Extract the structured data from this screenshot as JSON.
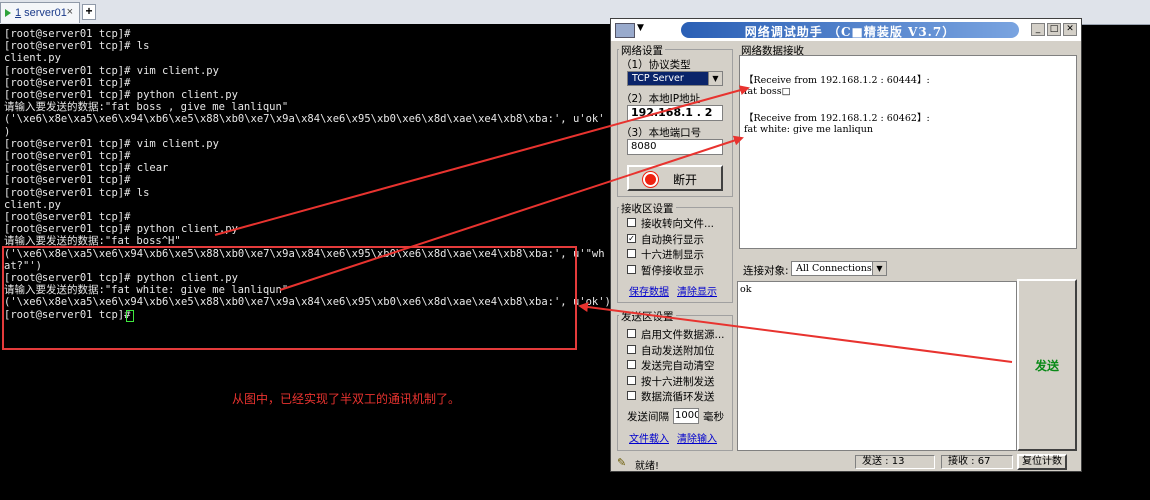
{
  "tab": {
    "number": "1",
    "name": "server01",
    "close": "×",
    "add": "+"
  },
  "terminal": {
    "lines": [
      "[root@server01 tcp]#",
      "[root@server01 tcp]# ls",
      "client.py",
      "[root@server01 tcp]# vim client.py",
      "[root@server01 tcp]#",
      "[root@server01 tcp]# python client.py",
      "请输入要发送的数据:\"fat boss , give me lanliqun\"",
      "('\\xe6\\x8e\\xa5\\xe6\\x94\\xb6\\xe5\\x88\\xb0\\xe7\\x9a\\x84\\xe6\\x95\\xb0\\xe6\\x8d\\xae\\xe4\\xb8\\xba:', u'ok'",
      ")",
      "[root@server01 tcp]# vim client.py",
      "[root@server01 tcp]#",
      "[root@server01 tcp]# clear",
      "[root@server01 tcp]#",
      "[root@server01 tcp]# ls",
      "client.py",
      "[root@server01 tcp]#",
      "[root@server01 tcp]# python client.py",
      "请输入要发送的数据:\"fat boss^H\"",
      "('\\xe6\\x8e\\xa5\\xe6\\x94\\xb6\\xe5\\x88\\xb0\\xe7\\x9a\\x84\\xe6\\x95\\xb0\\xe6\\x8d\\xae\\xe4\\xb8\\xba:', u'\"wh",
      "at?\"')",
      "[root@server01 tcp]# python client.py",
      "请输入要发送的数据:\"fat white: give me lanliqun\"",
      "('\\xe6\\x8e\\xa5\\xe6\\x94\\xb6\\xe5\\x88\\xb0\\xe7\\x9a\\x84\\xe6\\x95\\xb0\\xe6\\x8d\\xae\\xe4\\xb8\\xba:', u'ok')",
      "[root@server01 tcp]# "
    ],
    "caption": "从图中，已经实现了半双工的通讯机制了。"
  },
  "app": {
    "title": "网络调试助手 （C■精装版 V3.7）",
    "net_settings": {
      "group": "网络设置",
      "protocol_label": "（1）协议类型",
      "protocol_value": "TCP Server",
      "ip_label": "（2）本地IP地址",
      "ip_value": "192.168.1 . 2",
      "port_label": "（3）本地端口号",
      "port_value": "8080",
      "disconnect_label": "断开"
    },
    "recv_settings": {
      "group": "接收区设置",
      "options": [
        {
          "label": "接收转向文件...",
          "checked": false
        },
        {
          "label": "自动换行显示",
          "checked": true
        },
        {
          "label": "十六进制显示",
          "checked": false
        },
        {
          "label": "暂停接收显示",
          "checked": false
        }
      ],
      "save_link": "保存数据",
      "clear_link": "清除显示"
    },
    "send_settings": {
      "group": "发送区设置",
      "options": [
        {
          "label": "启用文件数据源...",
          "checked": false
        },
        {
          "label": "自动发送附加位",
          "checked": false
        },
        {
          "label": "发送完自动清空",
          "checked": false
        },
        {
          "label": "按十六进制发送",
          "checked": false
        },
        {
          "label": "数据流循环发送",
          "checked": false
        }
      ],
      "interval_label": "发送间隔",
      "interval_value": "1000",
      "interval_unit": "毫秒",
      "load_link": "文件载入",
      "clear_link": "清除输入"
    },
    "recv_area": {
      "group": "网络数据接收",
      "messages": [
        {
          "header": "【Receive from 192.168.1.2 : 60444】:",
          "body": "fat boss□"
        },
        {
          "header": "【Receive from 192.168.1.2 : 60462】:",
          "body": "fat white: give me lanliqun"
        }
      ]
    },
    "connect_label": "连接对象:",
    "connect_value": "All Connections",
    "send_text": "ok",
    "send_button": "发送",
    "status": {
      "ready": "就绪!",
      "sent": "发送 : 13",
      "received": "接收 : 67",
      "reset": "复位计数"
    }
  }
}
